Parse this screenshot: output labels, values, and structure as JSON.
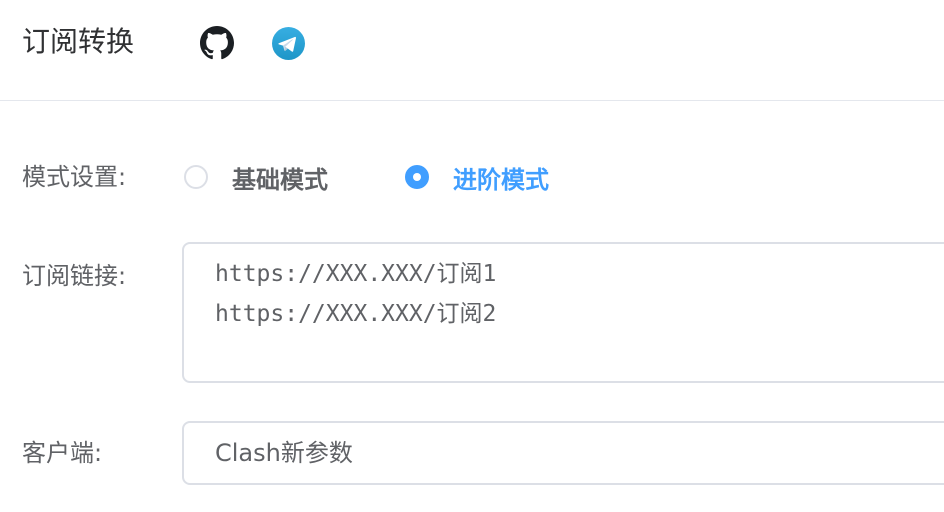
{
  "header": {
    "title": "订阅转换",
    "links": [
      {
        "icon": "github-icon"
      },
      {
        "icon": "telegram-icon"
      }
    ]
  },
  "form": {
    "mode": {
      "label": "模式设置:",
      "options": [
        {
          "label": "基础模式",
          "selected": false
        },
        {
          "label": "进阶模式",
          "selected": true
        }
      ]
    },
    "subscription": {
      "label": "订阅链接:",
      "lines": [
        "https://XXX.XXX/订阅1",
        "https://XXX.XXX/订阅2"
      ]
    },
    "client": {
      "label": "客户端:",
      "value": "Clash新参数"
    }
  },
  "colors": {
    "accent": "#409eff",
    "text": "#606266",
    "border": "#dcdfe6",
    "github": "#1b1f23",
    "telegram": "#37aee2"
  }
}
